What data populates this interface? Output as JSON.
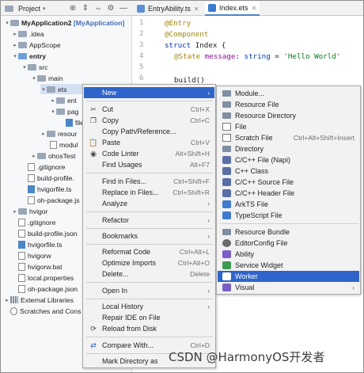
{
  "toolbar": {
    "project_label": "Project",
    "tabs": [
      {
        "label": "EntryAbility.ts"
      },
      {
        "label": "Index.ets"
      }
    ]
  },
  "tree": {
    "root": "MyApplication2",
    "root_tag": "[MyApplication]",
    "items": [
      ".idea",
      "AppScope",
      "entry",
      "src",
      "main",
      "ets",
      "ent",
      "pag",
      "file.ts",
      "resour",
      "modul",
      "ohosTest",
      ".gitignore",
      "build-profile.",
      "hvigorfile.ts",
      "oh-package.js",
      "hvigor",
      ".gitignore",
      "build-profile.json",
      "hvigorfile.ts",
      "hvigorw",
      "hvigorw.bat",
      "local.properties",
      "oh-package.json",
      "External Libraries",
      "Scratches and Cons"
    ]
  },
  "editor": {
    "lines": [
      "1",
      "2",
      "3",
      "4",
      "5",
      "6"
    ],
    "code": {
      "l1": "@Entry",
      "l2": "@Component",
      "l3_kw": "struct",
      "l3_id": " Index {",
      "l4_ann": "@State",
      "l4_id": " message",
      "l4_col": ": ",
      "l4_type": "string",
      "l4_eq": " = ",
      "l4_str": "'Hello World'",
      "l6": "build()"
    }
  },
  "menu": {
    "new": "New",
    "cut": "Cut",
    "cut_sc": "Ctrl+X",
    "copy": "Copy",
    "copy_sc": "Ctrl+C",
    "copy_path": "Copy Path/Reference...",
    "paste": "Paste",
    "paste_sc": "Ctrl+V",
    "code_linter": "Code Linter",
    "code_linter_sc": "Alt+Shift+H",
    "find_usages": "Find Usages",
    "find_usages_sc": "Alt+F7",
    "find_in_files": "Find in Files...",
    "find_in_files_sc": "Ctrl+Shift+F",
    "replace_in_files": "Replace in Files...",
    "replace_in_files_sc": "Ctrl+Shift+R",
    "analyze": "Analyze",
    "refactor": "Refactor",
    "bookmarks": "Bookmarks",
    "reformat": "Reformat Code",
    "reformat_sc": "Ctrl+Alt+L",
    "optimize": "Optimize Imports",
    "optimize_sc": "Ctrl+Alt+O",
    "delete": "Delete...",
    "delete_sc": "Delete",
    "open_in": "Open In",
    "local_history": "Local History",
    "repair_ide": "Repair IDE on File",
    "reload": "Reload from Disk",
    "compare": "Compare With...",
    "compare_sc": "Ctrl+D",
    "mark_dir": "Mark Directory as"
  },
  "submenu": {
    "module": "Module...",
    "resource_file": "Resource File",
    "resource_directory": "Resource Directory",
    "file": "File",
    "scratch_file": "Scratch File",
    "scratch_sc": "Ctrl+Alt+Shift+Insert",
    "directory": "Directory",
    "cpp_napi": "C/C++ File (Napi)",
    "cpp_class": "C++ Class",
    "cpp_source": "C/C++ Source File",
    "cpp_header": "C/C++ Header File",
    "arkts": "ArkTS File",
    "typescript": "TypeScript File",
    "resource_bundle": "Resource Bundle",
    "editorconfig": "EditorConfig File",
    "ability": "Ability",
    "service_widget": "Service Widget",
    "worker": "Worker",
    "visual": "Visual"
  },
  "watermark": "CSDN @HarmonyOS开发者"
}
